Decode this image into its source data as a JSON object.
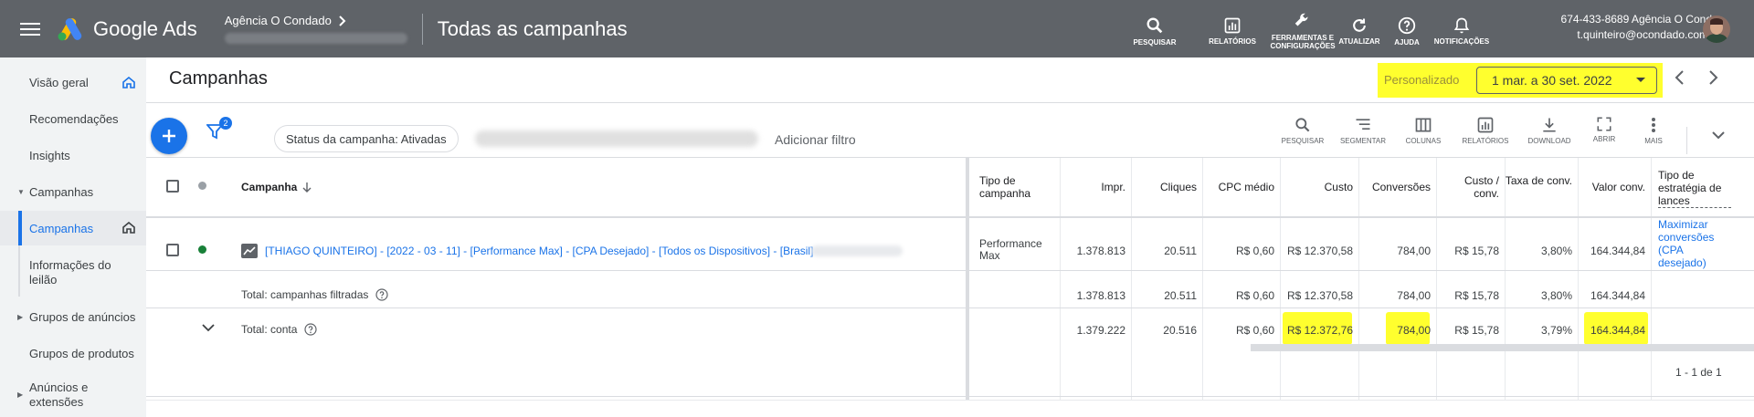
{
  "topbar": {
    "app_name": "Google Ads",
    "account_name": "Agência O Condado",
    "page_heading": "Todas as campanhas",
    "actions": [
      {
        "label": "PESQUISAR",
        "icon": "search-icon"
      },
      {
        "label": "RELATÓRIOS",
        "icon": "reports-icon"
      },
      {
        "label": "FERRAMENTAS E CONFIGURAÇÕES",
        "icon": "wrench-icon"
      },
      {
        "label": "ATUALIZAR",
        "icon": "refresh-icon"
      },
      {
        "label": "AJUDA",
        "icon": "help-icon"
      },
      {
        "label": "NOTIFICAÇÕES",
        "icon": "bell-icon"
      }
    ],
    "user_line1": "674-433-8689 Agência O Cond...",
    "user_line2": "t.quinteiro@ocondado.com.br"
  },
  "sidebar": {
    "items": [
      {
        "label": "Visão geral"
      },
      {
        "label": "Recomendações"
      },
      {
        "label": "Insights"
      },
      {
        "label": "Campanhas"
      },
      {
        "label": "Campanhas"
      },
      {
        "label": "Informações do leilão"
      },
      {
        "label": "Grupos de anúncios"
      },
      {
        "label": "Grupos de produtos"
      },
      {
        "label": "Anúncios e extensões"
      }
    ]
  },
  "header": {
    "title": "Campanhas",
    "date_custom_label": "Personalizado",
    "date_range": "1 mar. a 30 set. 2022"
  },
  "toolbar": {
    "filter_count": "2",
    "status_chip": "Status da campanha: Ativadas",
    "add_filter": "Adicionar filtro",
    "tools": [
      {
        "label": "PESQUISAR",
        "icon": "search-icon"
      },
      {
        "label": "SEGMENTAR",
        "icon": "segment-icon"
      },
      {
        "label": "COLUNAS",
        "icon": "columns-icon"
      },
      {
        "label": "RELATÓRIOS",
        "icon": "reports-icon"
      },
      {
        "label": "DOWNLOAD",
        "icon": "download-icon"
      },
      {
        "label": "ABRIR",
        "icon": "expand-icon"
      },
      {
        "label": "MAIS",
        "icon": "more-icon"
      }
    ]
  },
  "table": {
    "headers": {
      "campaign": "Campanha",
      "type": "Tipo de campanha",
      "impr": "Impr.",
      "clicks": "Cliques",
      "cpc": "CPC médio",
      "cost": "Custo",
      "conversions": "Conversões",
      "cost_conv": "Custo / conv.",
      "conv_rate": "Taxa de conv.",
      "conv_value": "Valor conv.",
      "bid_strategy": "Tipo de estratégia de lances"
    },
    "row": {
      "campaign": "[THIAGO QUINTEIRO] - [2022 - 03 - 11] - [Performance Max] - [CPA Desejado] - [Todos os Dispositivos] - [Brasil] -",
      "type": "Performance Max",
      "impr": "1.378.813",
      "clicks": "20.511",
      "cpc": "R$ 0,60",
      "cost": "R$ 12.370,58",
      "conversions": "784,00",
      "cost_conv": "R$ 15,78",
      "conv_rate": "3,80%",
      "conv_value": "164.344,84",
      "bid_strategy": "Maximizar conversões (CPA desejado)"
    },
    "total_filtered": {
      "label": "Total: campanhas filtradas",
      "impr": "1.378.813",
      "clicks": "20.511",
      "cpc": "R$ 0,60",
      "cost": "R$ 12.370,58",
      "conversions": "784,00",
      "cost_conv": "R$ 15,78",
      "conv_rate": "3,80%",
      "conv_value": "164.344,84"
    },
    "total_account": {
      "label": "Total: conta",
      "impr": "1.379.222",
      "clicks": "20.516",
      "cpc": "R$ 0,60",
      "cost": "R$ 12.372,76",
      "conversions": "784,00",
      "cost_conv": "R$ 15,78",
      "conv_rate": "3,79%",
      "conv_value": "164.344,84"
    }
  },
  "pagination": "1 - 1 de 1",
  "colors": {
    "highlight": "#ffff2e",
    "accent": "#1a73e8",
    "status_enabled": "#188038",
    "topbar": "#5f6368"
  }
}
